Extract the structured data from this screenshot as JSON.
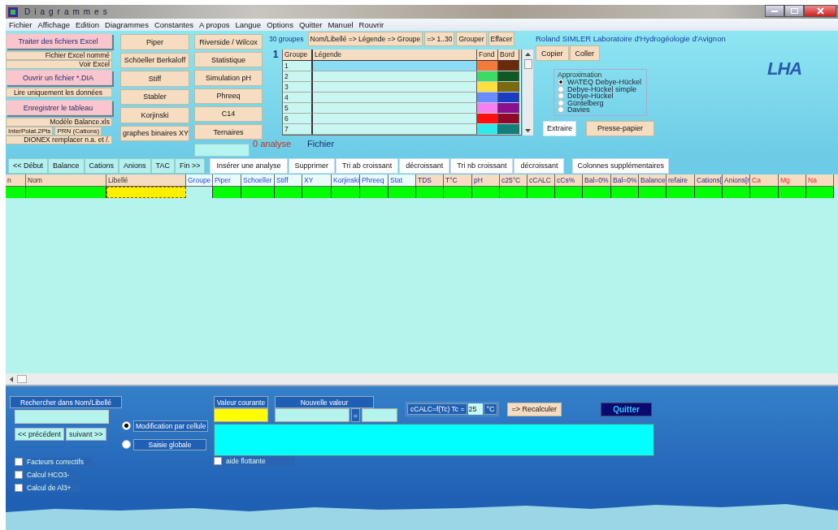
{
  "window": {
    "title": "Diagrammes"
  },
  "menu": [
    "Fichier",
    "Affichage",
    "Edition",
    "Diagrammes",
    "Constantes",
    "A propos",
    "Langue",
    "Options",
    "Quitter",
    "Manuel",
    "Rouvrir"
  ],
  "file_buttons": [
    {
      "kind": "main",
      "label": "Traiter des fichiers Excel"
    },
    {
      "kind": "small",
      "label": "Fichier Excel nommé"
    },
    {
      "kind": "small",
      "label": "Voir Excel"
    },
    {
      "kind": "main",
      "label": "Ouvrir un fichier *.DIA"
    },
    {
      "kind": "plain",
      "label": "Lire uniquement les données"
    },
    {
      "kind": "main",
      "label": "Enregistrer le tableau"
    },
    {
      "kind": "small",
      "label": "Modèle Balance.xls"
    },
    {
      "kind": "pair",
      "labels": [
        "InterPolat.2Pts",
        "PRN (Cations)"
      ]
    },
    {
      "kind": "small",
      "label": "DIONEX remplacer n.a. et /."
    }
  ],
  "diagram_buttons": [
    "Piper",
    "Schöeller Berkaloff",
    "Stiff",
    "Stabler",
    "Korjinski",
    "graphes binaires XY"
  ],
  "tool_buttons": [
    "Riverside / Wilcox",
    "Statistique",
    "Simulation pH",
    "Phreeq",
    "C14",
    "Ternaires"
  ],
  "analysis_count": "0 analyse",
  "file_label": "Fichier",
  "groups": {
    "count_label": "30 groupes",
    "buttons": [
      "Nom/Libellé => Légende => Groupe",
      "=> 1..30",
      "Grouper",
      "Effacer"
    ],
    "page": "1",
    "columns": [
      "Groupe",
      "Légende",
      "Fond",
      "Bord"
    ],
    "rows": [
      {
        "group": "1",
        "selected": true,
        "swatches": [
          {
            "color": "#f57a3a"
          },
          {
            "color": "#6b2b0b"
          }
        ]
      },
      {
        "group": "2",
        "selected": false,
        "swatches": [
          {
            "color": "#3cdc64"
          },
          {
            "color": "#0e5a22"
          }
        ]
      },
      {
        "group": "3",
        "selected": false,
        "swatches": [
          {
            "color": "#ffe040"
          },
          {
            "color": "#7a6a10"
          }
        ]
      },
      {
        "group": "4",
        "selected": false,
        "swatches": [
          {
            "color": "#6a8cff"
          },
          {
            "color": "#1a3cc0"
          }
        ]
      },
      {
        "group": "5",
        "selected": false,
        "swatches": [
          {
            "color": "#f580f0"
          },
          {
            "color": "#8a1090"
          }
        ]
      },
      {
        "group": "6",
        "selected": false,
        "swatches": [
          {
            "color": "#ff1010"
          },
          {
            "color": "#900a28"
          }
        ]
      },
      {
        "group": "7",
        "selected": false,
        "swatches": [
          {
            "color": "#30e8e8"
          },
          {
            "color": "#108078"
          }
        ]
      }
    ]
  },
  "credit": "Roland SIMLER Laboratoire d'Hydrogéologie d'Avignon",
  "logo": "LHA",
  "clipboard_buttons": [
    "Copier",
    "Coller"
  ],
  "approximation": {
    "title": "Approximation",
    "options": [
      {
        "label": "WATEQ Debye-Hückel",
        "selected": true
      },
      {
        "label": "Debye-Hückel simple",
        "selected": false
      },
      {
        "label": "Debye-Hückel",
        "selected": false
      },
      {
        "label": "Güntelberg",
        "selected": false
      },
      {
        "label": "Davies",
        "selected": false
      }
    ]
  },
  "extract_button": "Extraire",
  "clipboard_export_button": "Presse-papier",
  "nav_buttons": [
    "<< Début",
    "Balance",
    "Cations",
    "Anions",
    "TAC",
    "Fin >>"
  ],
  "action_buttons": [
    "Insérer une analyse",
    "Supprimer",
    "Tri ab croissant",
    "décroissant",
    "Tri nb croissant",
    "décroissant"
  ],
  "extra_columns_button": "Colonnes supplémentaires",
  "table": {
    "columns": [
      {
        "label": "n",
        "kind": "base"
      },
      {
        "label": "Nom",
        "kind": "base"
      },
      {
        "label": "Libellé",
        "kind": "base"
      },
      {
        "label": "Groupe",
        "kind": "diagram"
      },
      {
        "label": "Piper",
        "kind": "diagram"
      },
      {
        "label": "Schoeller",
        "kind": "diagram"
      },
      {
        "label": "Stiff",
        "kind": "diagram"
      },
      {
        "label": "XY",
        "kind": "diagram"
      },
      {
        "label": "Korjinski",
        "kind": "diagram"
      },
      {
        "label": "Phreeq",
        "kind": "diagram"
      },
      {
        "label": "Stat",
        "kind": "diagram"
      },
      {
        "label": "TDS",
        "kind": "value"
      },
      {
        "label": "T°C",
        "kind": "value"
      },
      {
        "label": "pH",
        "kind": "value"
      },
      {
        "label": "c25°C",
        "kind": "value"
      },
      {
        "label": "cCALC",
        "kind": "value"
      },
      {
        "label": "cCs%",
        "kind": "value"
      },
      {
        "label": "Bal=0%",
        "kind": "value"
      },
      {
        "label": "Bal=0%",
        "kind": "value"
      },
      {
        "label": "Balance",
        "kind": "value"
      },
      {
        "label": "refaire",
        "kind": "value"
      },
      {
        "label": "Cations[",
        "kind": "value"
      },
      {
        "label": "Anions[r",
        "kind": "value"
      },
      {
        "label": "Ca",
        "kind": "ion"
      },
      {
        "label": "Mg",
        "kind": "ion"
      },
      {
        "label": "Na",
        "kind": "ion"
      }
    ],
    "row": [
      {
        "selected": false
      },
      {
        "selected": false
      },
      {
        "selected": true
      },
      {
        "selected": false
      },
      {
        "selected": false
      },
      {
        "selected": false
      },
      {
        "selected": false
      },
      {
        "selected": false
      },
      {
        "selected": false
      },
      {
        "selected": false
      },
      {
        "selected": false
      },
      {
        "selected": false
      },
      {
        "selected": false
      },
      {
        "selected": false
      },
      {
        "selected": false
      },
      {
        "selected": false
      },
      {
        "selected": false
      },
      {
        "selected": false
      },
      {
        "selected": false
      },
      {
        "selected": false
      },
      {
        "selected": false
      },
      {
        "selected": false
      },
      {
        "selected": false
      },
      {
        "selected": false
      },
      {
        "selected": false
      },
      {
        "selected": false
      }
    ]
  },
  "search": {
    "label": "Rechercher dans Nom/Libellé",
    "prev": "<< précédent",
    "next": "suivant >>"
  },
  "edit_modes": [
    {
      "label": "Modification par cellule",
      "selected": true
    },
    {
      "label": "Saisie globale",
      "selected": false
    }
  ],
  "options": [
    {
      "label": "Facteurs correctifs",
      "checked": false
    },
    {
      "label": "Calcul HCO3-",
      "checked": false
    },
    {
      "label": "Calcul de Al3+",
      "checked": false
    }
  ],
  "current_value_label": "Valeur courante",
  "new_value_label": "Nouvelle valeur",
  "equals_button": "=",
  "floating_help": {
    "label": "aide flottante",
    "checked": false
  },
  "temperature": {
    "label": "cCALC=f(Tc) Tc =",
    "value": "25",
    "unit": "°C"
  },
  "recalc_button": "=> Recalculer",
  "quit_button": "Quitter"
}
